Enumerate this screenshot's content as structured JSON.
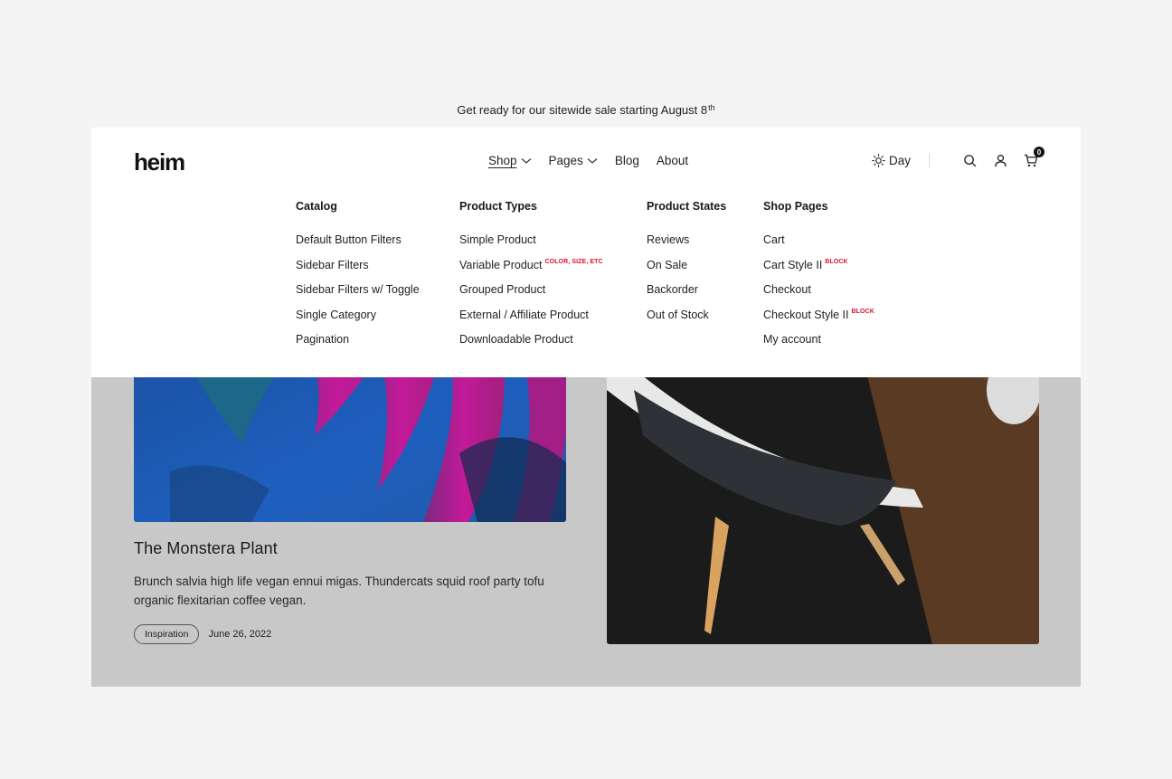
{
  "announcement": {
    "text": "Get ready for our sitewide sale starting August 8",
    "sup": "th"
  },
  "header": {
    "logo": "heim",
    "nav": [
      {
        "label": "Shop",
        "dropdown": true,
        "active": true
      },
      {
        "label": "Pages",
        "dropdown": true,
        "active": false
      },
      {
        "label": "Blog",
        "dropdown": false,
        "active": false
      },
      {
        "label": "About",
        "dropdown": false,
        "active": false
      }
    ],
    "day_label": "Day",
    "cart_count": "0"
  },
  "mega_menu": {
    "columns": [
      {
        "heading": "Catalog",
        "items": [
          {
            "label": "Default Button Filters",
            "badge": ""
          },
          {
            "label": "Sidebar Filters",
            "badge": ""
          },
          {
            "label": "Sidebar Filters w/ Toggle",
            "badge": ""
          },
          {
            "label": "Single Category",
            "badge": ""
          },
          {
            "label": "Pagination",
            "badge": ""
          }
        ]
      },
      {
        "heading": "Product Types",
        "items": [
          {
            "label": "Simple Product",
            "badge": ""
          },
          {
            "label": "Variable Product",
            "badge": "COLOR, SIZE, ETC"
          },
          {
            "label": "Grouped Product",
            "badge": ""
          },
          {
            "label": "External / Affiliate Product",
            "badge": ""
          },
          {
            "label": "Downloadable Product",
            "badge": ""
          }
        ]
      },
      {
        "heading": "Product States",
        "items": [
          {
            "label": "Reviews",
            "badge": ""
          },
          {
            "label": "On Sale",
            "badge": ""
          },
          {
            "label": "Backorder",
            "badge": ""
          },
          {
            "label": "Out of Stock",
            "badge": ""
          }
        ]
      },
      {
        "heading": "Shop Pages",
        "items": [
          {
            "label": "Cart",
            "badge": ""
          },
          {
            "label": "Cart Style II",
            "badge": "BLOCK"
          },
          {
            "label": "Checkout",
            "badge": ""
          },
          {
            "label": "Checkout Style II",
            "badge": "BLOCK"
          },
          {
            "label": "My account",
            "badge": ""
          }
        ]
      }
    ]
  },
  "posts": {
    "left": {
      "title": "The Monstera Plant",
      "excerpt": "Brunch salvia high life vegan ennui migas. Thundercats squid roof party tofu organic flexitarian coffee vegan.",
      "tag": "Inspiration",
      "date": "June 26, 2022"
    }
  },
  "colors": {
    "badge": "#e0102a",
    "overlay": "#c8c8c8",
    "header_bg": "#ffffff"
  }
}
